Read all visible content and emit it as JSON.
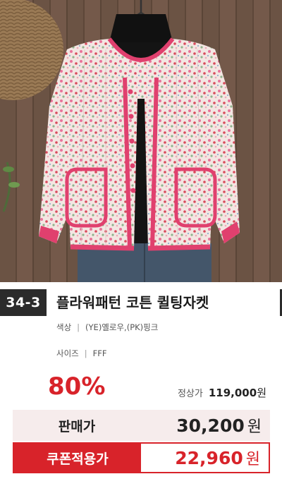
{
  "product": {
    "code": "34-3",
    "title": "플라워패턴 코튼 퀼팅자켓",
    "color_label": "색상",
    "color_value": "(YE)옐로우,(PK)핑크",
    "size_label": "사이즈",
    "size_value": "FFF",
    "separator": "|"
  },
  "pricing": {
    "discount": "80%",
    "regular_label": "정상가",
    "regular_price": "119,000",
    "sale_label": "판매가",
    "sale_price": "30,200",
    "coupon_label": "쿠폰적용가",
    "coupon_price": "22,960",
    "currency": "원"
  },
  "colors": {
    "accent_red": "#d8232a",
    "badge_dark": "#2b2b2b",
    "sale_bg": "#f6ecec"
  }
}
